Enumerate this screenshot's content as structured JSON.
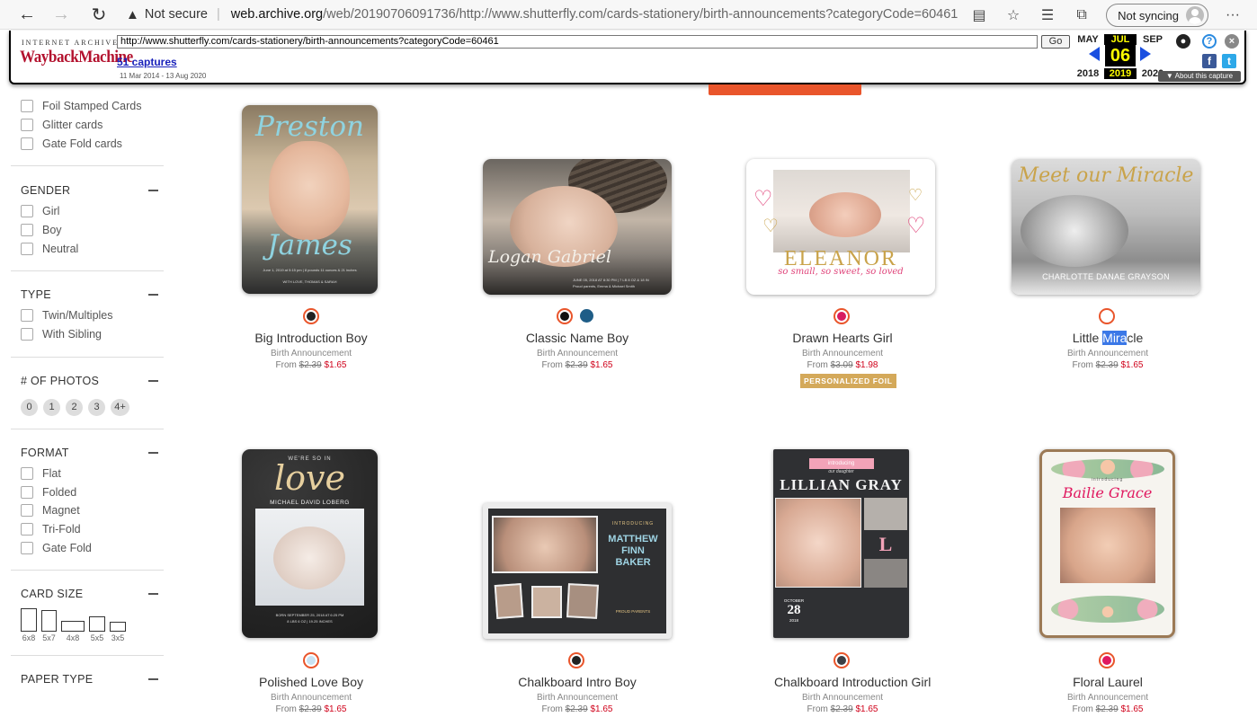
{
  "browser": {
    "not_secure": "Not secure",
    "url_host": "web.archive.org",
    "url_path": "/web/20190706091736/http://www.shutterfly.com/cards-stationery/birth-announcements?categoryCode=60461",
    "sync_label": "Not syncing"
  },
  "wayback": {
    "logo_top": "INTERNET ARCHIVE",
    "logo_main": "WaybackMachine",
    "url": "http://www.shutterfly.com/cards-stationery/birth-announcements?categoryCode=60461",
    "go": "Go",
    "captures": "51 captures",
    "range": "11 Mar 2014 - 13 Aug 2020",
    "months": [
      "MAY",
      "JUL",
      "SEP"
    ],
    "day": "06",
    "years": [
      "2018",
      "2019",
      "2020"
    ],
    "about": "▼ About this capture"
  },
  "filters": {
    "card_type_items": [
      "Foil Stamped Cards",
      "Glitter cards",
      "Gate Fold cards"
    ],
    "gender": {
      "title": "GENDER",
      "items": [
        "Girl",
        "Boy",
        "Neutral"
      ]
    },
    "type": {
      "title": "TYPE",
      "items": [
        "Twin/Multiples",
        "With Sibling"
      ]
    },
    "photos": {
      "title": "# OF PHOTOS",
      "items": [
        "0",
        "1",
        "2",
        "3",
        "4+"
      ]
    },
    "format": {
      "title": "FORMAT",
      "items": [
        "Flat",
        "Folded",
        "Magnet",
        "Tri-Fold",
        "Gate Fold"
      ]
    },
    "card_size": {
      "title": "CARD SIZE",
      "items": [
        "6x8",
        "5x7",
        "4x8",
        "5x5",
        "3x5"
      ]
    },
    "paper_type": {
      "title": "PAPER TYPE"
    }
  },
  "products": [
    {
      "name": "Big Introduction Boy",
      "type": "Birth Announcement",
      "from": "From",
      "old_price": "$2.39",
      "price": "$1.65",
      "card_text": [
        "Preston",
        "James",
        "June 1, 2019 at 5:15 pm | 8 pounds 11 ounces & 21 inches",
        "WITH LOVE, THOMAS & SARAH"
      ],
      "swatches": [
        "#222222"
      ]
    },
    {
      "name": "Classic Name Boy",
      "type": "Birth Announcement",
      "from": "From",
      "old_price": "$2.39",
      "price": "$1.65",
      "card_text": [
        "Logan Gabriel",
        "JUNE 05, 2018 AT 8:30 PM | 7 LB 8 OZ & 18 IN",
        "Proud parents, Emma & Michael Smith"
      ],
      "swatches": [
        "#111111",
        "#1f5d87"
      ]
    },
    {
      "name": "Drawn Hearts Girl",
      "type": "Birth Announcement",
      "from": "From",
      "old_price": "$3.09",
      "price": "$1.98",
      "badge": "PERSONALIZED FOIL",
      "card_text": [
        "ELEANOR",
        "so small, so sweet, so loved"
      ],
      "swatches": [
        "#d81b60"
      ]
    },
    {
      "name": "Little Miracle",
      "name_parts": [
        "Little ",
        "Mira",
        "cle"
      ],
      "type": "Birth Announcement",
      "from": "From",
      "old_price": "$2.39",
      "price": "$1.65",
      "card_text": [
        "Meet our Miracle",
        "CHARLOTTE DANAE GRAYSON"
      ],
      "swatches": [
        "#ffffff"
      ]
    },
    {
      "name": "Polished Love Boy",
      "type": "Birth Announcement",
      "from": "From",
      "old_price": "$2.39",
      "price": "$1.65",
      "card_text": [
        "WE'RE SO IN",
        "love",
        "MICHAEL DAVID LOBERG",
        "BORN SEPTEMBER 25, 2018 AT 6:25 PM",
        "8 LBS 6 OZ | 19.25 INCHES"
      ],
      "swatches": [
        "#c9e2f2"
      ]
    },
    {
      "name": "Chalkboard Intro Boy",
      "type": "Birth Announcement",
      "from": "From",
      "old_price": "$2.39",
      "price": "$1.65",
      "card_text": [
        "INTRODUCING",
        "MATTHEW",
        "FINN",
        "BAKER",
        "PROUD PARENTS"
      ],
      "swatches": [
        "#222222"
      ]
    },
    {
      "name": "Chalkboard Introduction Girl",
      "type": "Birth Announcement",
      "from": "From",
      "old_price": "$2.39",
      "price": "$1.65",
      "card_text": [
        "introducing",
        "our daughter",
        "LILLIAN GRAY",
        "L",
        "OCTOBER",
        "28",
        "2018"
      ],
      "swatches": [
        "#3b3f45"
      ]
    },
    {
      "name": "Floral Laurel",
      "type": "Birth Announcement",
      "from": "From",
      "old_price": "$2.39",
      "price": "$1.65",
      "card_text": [
        "introducing",
        "Bailie Grace"
      ],
      "swatches": [
        "#e0185f"
      ]
    }
  ]
}
